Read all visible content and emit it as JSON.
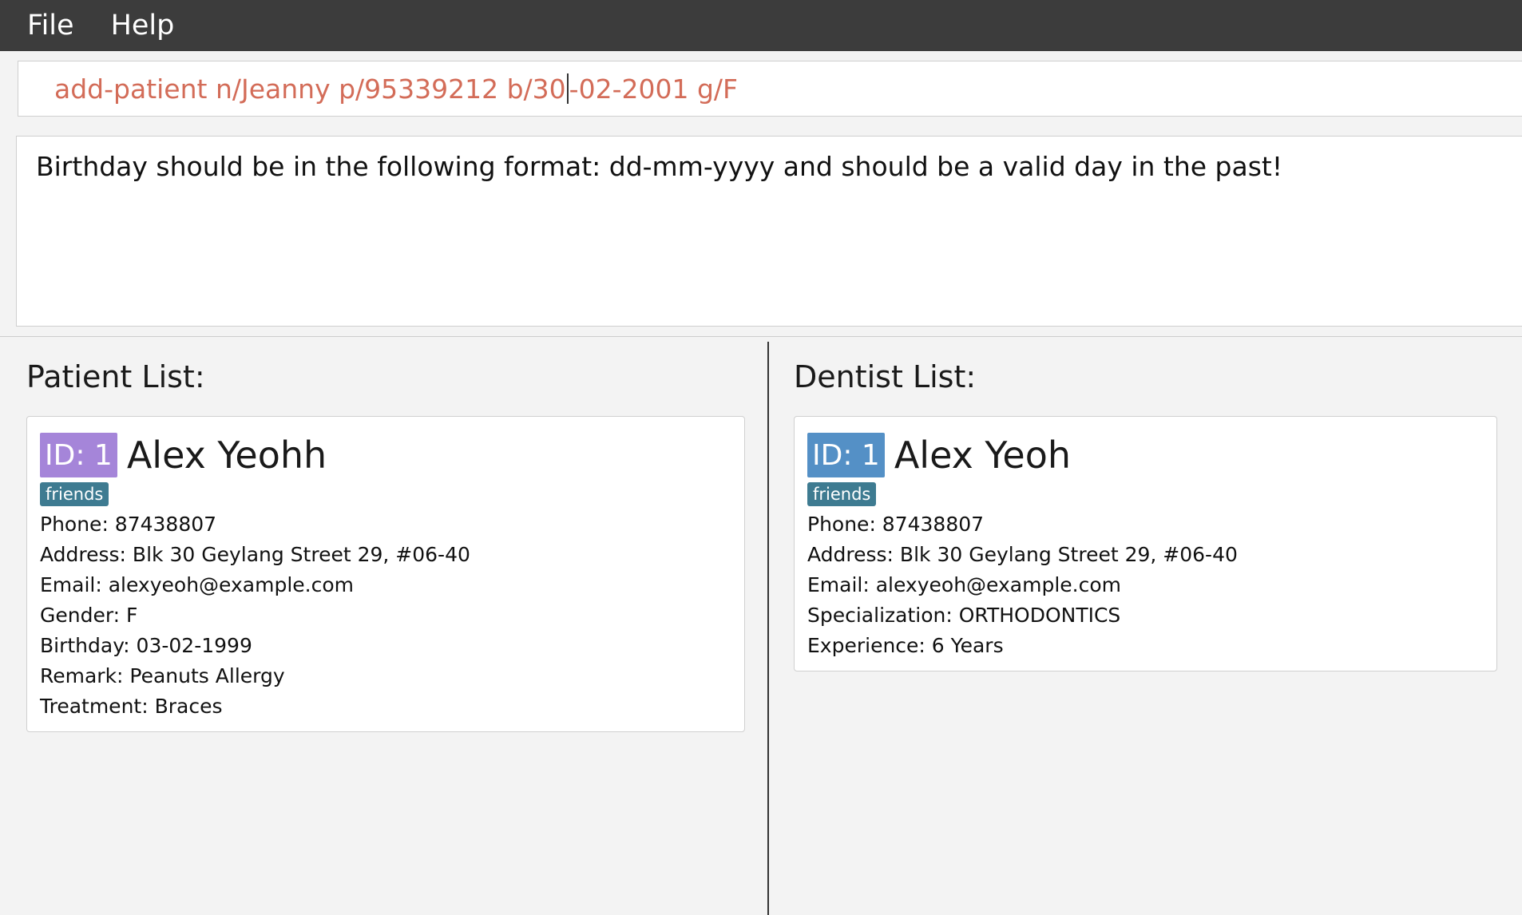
{
  "menu": {
    "file": "File",
    "help": "Help"
  },
  "command": {
    "before_caret": "add-patient n/Jeanny p/95339212 b/30",
    "after_caret": "-02-2001 g/F",
    "value": "add-patient n/Jeanny p/95339212 b/30-02-2001 g/F"
  },
  "result": {
    "message": "Birthday should be in the following format: dd-mm-yyyy and should be a valid day in the past!"
  },
  "patients": {
    "title": "Patient List:",
    "items": [
      {
        "id": "ID: 1",
        "name": "Alex Yeohh",
        "tag": "friends",
        "phone": "Phone: 87438807",
        "address": "Address: Blk 30 Geylang Street 29, #06-40",
        "email": "Email: alexyeoh@example.com",
        "gender": "Gender: F",
        "birthday": "Birthday: 03-02-1999",
        "remark": "Remark: Peanuts Allergy",
        "treatment": "Treatment: Braces"
      }
    ]
  },
  "dentists": {
    "title": "Dentist List:",
    "items": [
      {
        "id": "ID: 1",
        "name": "Alex Yeoh",
        "tag": "friends",
        "phone": "Phone: 87438807",
        "address": "Address: Blk 30 Geylang Street 29, #06-40",
        "email": "Email: alexyeoh@example.com",
        "specialization": "Specialization: ORTHODONTICS",
        "experience": "Experience: 6 Years"
      }
    ]
  },
  "colors": {
    "patient_badge": "#a585d9",
    "dentist_badge": "#5490c6",
    "tag": "#3e7b91",
    "command_text": "#d36c58",
    "menubar": "#3c3c3c"
  }
}
